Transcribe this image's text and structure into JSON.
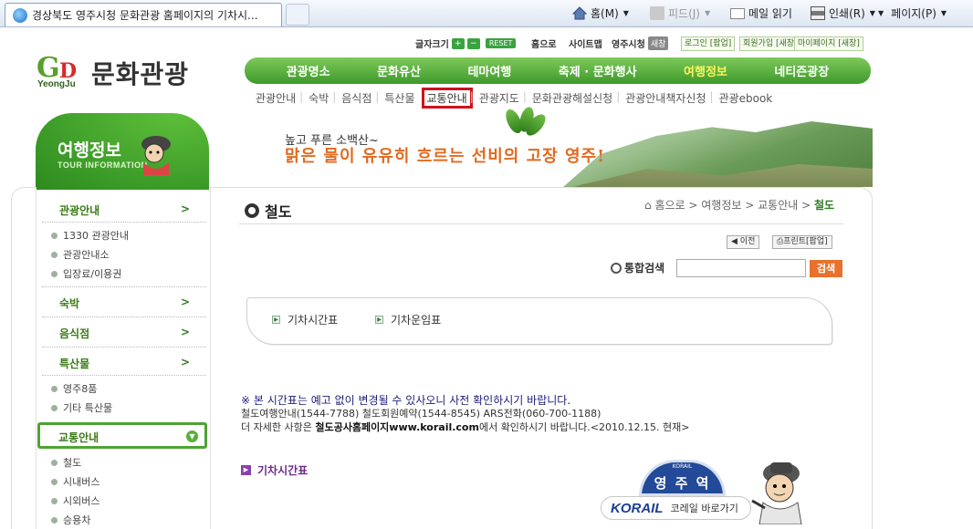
{
  "browser": {
    "tab_title": "경상북도 영주시청 문화관광 홈페이지의 기차시...",
    "commands": {
      "home": "홈(M)",
      "feeds": "피드(J)",
      "read_mail": "메일 읽기",
      "print": "인쇄(R)",
      "page": "페이지(P)"
    }
  },
  "site": {
    "logo_text": "문화관광",
    "logo_sub": "YeongJu",
    "util": {
      "font_size": "글자크기",
      "reset": "RESET",
      "home": "홈으로",
      "sitemap": "사이트맵",
      "cityhall": "영주시청",
      "new_window": "새창",
      "login": "로그인 [팝업]",
      "join": "회원가입 [새창]",
      "mypage": "마이페이지 [새창]"
    },
    "gnb": [
      "관광명소",
      "문화유산",
      "테마여행",
      "축제 · 문화행사",
      "여행정보",
      "네티즌광장"
    ],
    "gnb_active": "여행정보",
    "lnb": [
      "관광안내",
      "숙박",
      "음식점",
      "특산물",
      "교통안내",
      "관광지도",
      "문화관광해설신청",
      "관광안내책자신청",
      "관광ebook"
    ],
    "lnb_active": "교통안내",
    "banner": {
      "line1": "높고 푸른 소백산~",
      "line2": "맑은 물이 유유히 흐르는 선비의 고장 영주!"
    }
  },
  "left": {
    "title": "여행정보",
    "subtitle": "TOUR INFORMATION",
    "menu": [
      {
        "label": "관광안내",
        "subs": [
          "1330 관광안내",
          "관광안내소",
          "입장료/이용권"
        ]
      },
      {
        "label": "숙박",
        "subs": []
      },
      {
        "label": "음식점",
        "subs": []
      },
      {
        "label": "특산물",
        "subs": [
          "영주8품",
          "기타 특산물"
        ]
      },
      {
        "label": "교통안내",
        "subs": [
          "철도",
          "시내버스",
          "시외버스",
          "승용차"
        ]
      }
    ],
    "arrow": ">"
  },
  "content": {
    "title": "철도",
    "breadcrumb": [
      "홈으로",
      "여행정보",
      "교통안내",
      "철도"
    ],
    "prev": "이전",
    "print": "프린트[팝업]",
    "search_label": "통합검색",
    "search_value": "",
    "search_button": "검색",
    "tabs": [
      "기차시간표",
      "기차운임표"
    ],
    "notice": "※ 본 시간표는 예고 없이 변경될 수 있사오니 사전 확인하시기 바랍니다.",
    "contacts": "철도여행안내(1544-7788)     철도회원예약(1544-8545)      ARS전화(060-700-1188)",
    "more_pre": "더 자세한 사항은 ",
    "more_bold": "철도공사홈페이지www.korail.com",
    "more_post": "에서 확인하시기 바랍니다.<2010.12.15. 현재>",
    "section_title": "기차시간표",
    "station_name": "영 주 역",
    "station_small": "KORAIL",
    "korail_logo": "KORAIL",
    "korail_go": "코레일 바로가기"
  }
}
